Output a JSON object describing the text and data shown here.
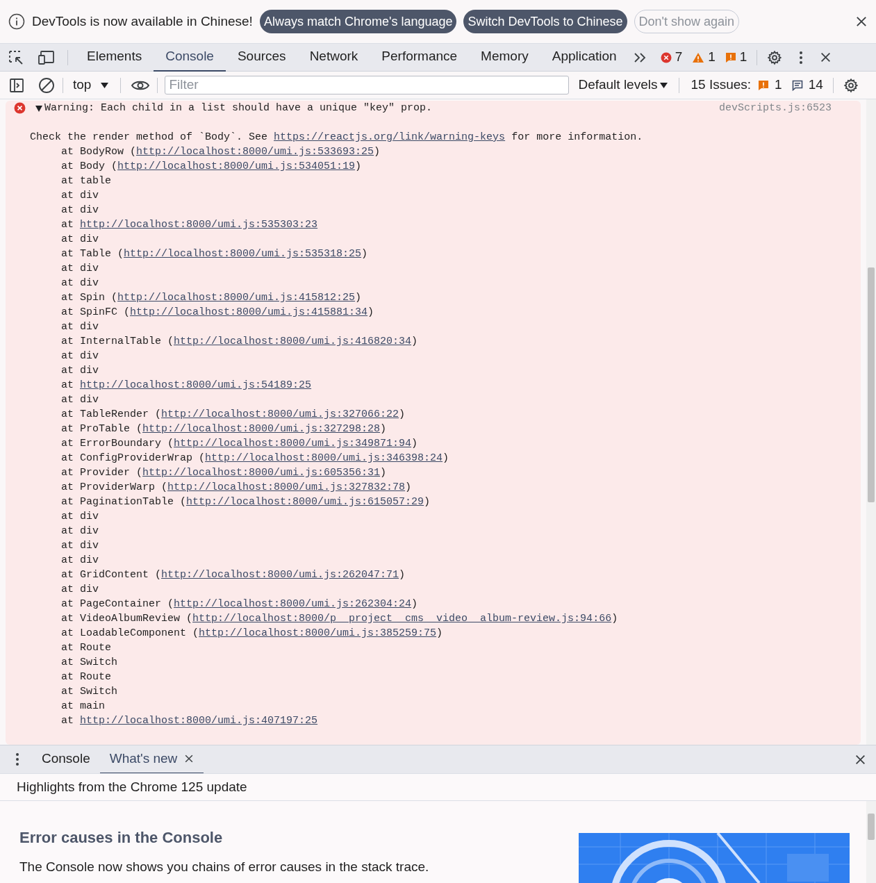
{
  "infobar": {
    "message": "DevTools is now available in Chinese!",
    "buttons": [
      {
        "label": "Always match Chrome's language",
        "kind": "primary"
      },
      {
        "label": "Switch DevTools to Chinese",
        "kind": "primary"
      },
      {
        "label": "Don't show again",
        "kind": "outline"
      }
    ]
  },
  "tabs": [
    {
      "label": "Elements",
      "selected": false
    },
    {
      "label": "Console",
      "selected": true
    },
    {
      "label": "Sources",
      "selected": false
    },
    {
      "label": "Network",
      "selected": false
    },
    {
      "label": "Performance",
      "selected": false
    },
    {
      "label": "Memory",
      "selected": false
    },
    {
      "label": "Application",
      "selected": false
    }
  ],
  "counters": [
    {
      "kind": "error",
      "count": "7"
    },
    {
      "kind": "warning",
      "count": "1"
    },
    {
      "kind": "issue",
      "count": "1"
    }
  ],
  "toolbar": {
    "context": "top",
    "filter_placeholder": "Filter",
    "levels": "Default levels",
    "issues_label": "15 Issues:",
    "issue_counts": [
      {
        "kind": "issue",
        "count": "1"
      },
      {
        "kind": "info",
        "count": "14"
      }
    ]
  },
  "message": {
    "expanded": true,
    "title": "Warning: Each child in a list should have a unique \"key\" prop.",
    "source": "devScripts.js:6523",
    "check": {
      "before": "Check the render method of `Body`. See ",
      "link": "https://reactjs.org/link/warning-keys",
      "after": " for more information."
    },
    "frames": [
      {
        "prefix": "at BodyRow (",
        "link": "http://localhost:8000/umi.js:533693:25",
        "suffix": ")"
      },
      {
        "prefix": "at Body (",
        "link": "http://localhost:8000/umi.js:534051:19",
        "suffix": ")"
      },
      {
        "prefix": "at table"
      },
      {
        "prefix": "at div"
      },
      {
        "prefix": "at div"
      },
      {
        "prefix": "at ",
        "link": "http://localhost:8000/umi.js:535303:23"
      },
      {
        "prefix": "at div"
      },
      {
        "prefix": "at Table (",
        "link": "http://localhost:8000/umi.js:535318:25",
        "suffix": ")"
      },
      {
        "prefix": "at div"
      },
      {
        "prefix": "at div"
      },
      {
        "prefix": "at Spin (",
        "link": "http://localhost:8000/umi.js:415812:25",
        "suffix": ")"
      },
      {
        "prefix": "at SpinFC (",
        "link": "http://localhost:8000/umi.js:415881:34",
        "suffix": ")"
      },
      {
        "prefix": "at div"
      },
      {
        "prefix": "at InternalTable (",
        "link": "http://localhost:8000/umi.js:416820:34",
        "suffix": ")"
      },
      {
        "prefix": "at div"
      },
      {
        "prefix": "at div"
      },
      {
        "prefix": "at ",
        "link": "http://localhost:8000/umi.js:54189:25"
      },
      {
        "prefix": "at div"
      },
      {
        "prefix": "at TableRender (",
        "link": "http://localhost:8000/umi.js:327066:22",
        "suffix": ")"
      },
      {
        "prefix": "at ProTable (",
        "link": "http://localhost:8000/umi.js:327298:28",
        "suffix": ")"
      },
      {
        "prefix": "at ErrorBoundary (",
        "link": "http://localhost:8000/umi.js:349871:94",
        "suffix": ")"
      },
      {
        "prefix": "at ConfigProviderWrap (",
        "link": "http://localhost:8000/umi.js:346398:24",
        "suffix": ")"
      },
      {
        "prefix": "at Provider (",
        "link": "http://localhost:8000/umi.js:605356:31",
        "suffix": ")"
      },
      {
        "prefix": "at ProviderWarp (",
        "link": "http://localhost:8000/umi.js:327832:78",
        "suffix": ")"
      },
      {
        "prefix": "at PaginationTable (",
        "link": "http://localhost:8000/umi.js:615057:29",
        "suffix": ")"
      },
      {
        "prefix": "at div"
      },
      {
        "prefix": "at div"
      },
      {
        "prefix": "at div"
      },
      {
        "prefix": "at div"
      },
      {
        "prefix": "at GridContent (",
        "link": "http://localhost:8000/umi.js:262047:71",
        "suffix": ")"
      },
      {
        "prefix": "at div"
      },
      {
        "prefix": "at PageContainer (",
        "link": "http://localhost:8000/umi.js:262304:24",
        "suffix": ")"
      },
      {
        "prefix": "at VideoAlbumReview (",
        "link": "http://localhost:8000/p__project__cms__video__album-review.js:94:66",
        "suffix": ")"
      },
      {
        "prefix": "at LoadableComponent (",
        "link": "http://localhost:8000/umi.js:385259:75",
        "suffix": ")"
      },
      {
        "prefix": "at Route"
      },
      {
        "prefix": "at Switch"
      },
      {
        "prefix": "at Route"
      },
      {
        "prefix": "at Switch"
      },
      {
        "prefix": "at main"
      },
      {
        "prefix": "at ",
        "link": "http://localhost:8000/umi.js:407197:25"
      }
    ]
  },
  "drawer": {
    "tabs": [
      {
        "label": "Console",
        "selected": false,
        "closable": false
      },
      {
        "label": "What's new",
        "selected": true,
        "closable": true
      }
    ],
    "header": "Highlights from the Chrome 125 update",
    "article": {
      "heading": "Error causes in the Console",
      "body": "The Console now shows you chains of error causes in the stack trace."
    }
  }
}
